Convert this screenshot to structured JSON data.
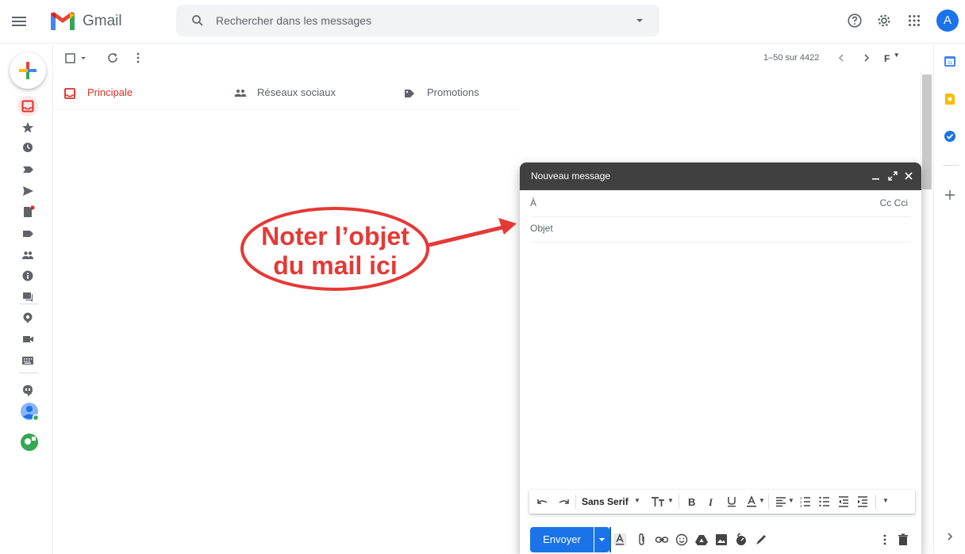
{
  "app": {
    "name": "Gmail",
    "avatar_letter": "A"
  },
  "search": {
    "placeholder": "Rechercher dans les messages"
  },
  "toolbar": {
    "pagination": "1–50 sur 4422",
    "input_tools_label": "F"
  },
  "tabs": [
    {
      "label": "Principale",
      "active": true
    },
    {
      "label": "Réseaux sociaux",
      "active": false
    },
    {
      "label": "Promotions",
      "active": false
    }
  ],
  "compose": {
    "title": "Nouveau message",
    "to_label": "À",
    "cc_label": "Cc Cci",
    "subject_placeholder": "Objet",
    "font_name": "Sans Serif",
    "send_label": "Envoyer"
  },
  "annotation": {
    "line1": "Noter l’objet",
    "line2": "du mail ici"
  },
  "colors": {
    "gmail_red": "#d93025",
    "accent_blue": "#1a73e8",
    "annotation_red": "#e53935",
    "compose_header": "#404040"
  },
  "icons": [
    "menu-icon",
    "gmail-logo-icon",
    "search-icon",
    "help-icon",
    "settings-icon",
    "apps-icon",
    "compose-plus-icon",
    "inbox-icon",
    "star-icon",
    "clock-icon",
    "important-icon",
    "send-icon",
    "draft-icon",
    "label-icon",
    "people-icon",
    "info-icon",
    "forum-icon",
    "meet-icon",
    "video-icon",
    "keyboard-icon",
    "hangouts-icon",
    "calendar-icon",
    "keep-icon",
    "tasks-icon"
  ]
}
